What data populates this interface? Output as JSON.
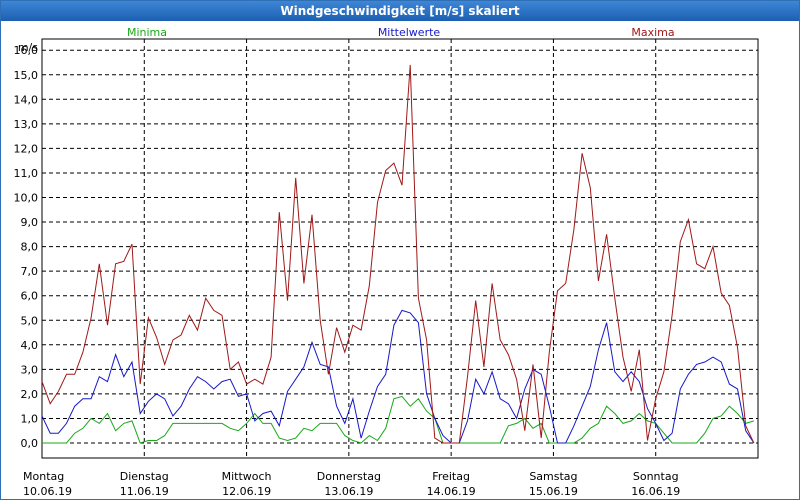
{
  "window": {
    "title": "Windgeschwindigkeit [m/s] skaliert"
  },
  "chart_data": {
    "type": "line",
    "title": "Windgeschwindigkeit [m/s] skaliert",
    "ylabel": "m/s",
    "ylim": [
      0,
      16.5
    ],
    "yticks": [
      "0,0",
      "1,0",
      "2,0",
      "3,0",
      "4,0",
      "5,0",
      "6,0",
      "7,0",
      "8,0",
      "9,0",
      "10,0",
      "11,0",
      "12,0",
      "13,0",
      "14,0",
      "15,0",
      "16,0"
    ],
    "xlim": [
      0,
      7
    ],
    "grid": true,
    "legend": "top",
    "days": [
      {
        "weekday": "Montag",
        "date": "10.06.19"
      },
      {
        "weekday": "Dienstag",
        "date": "11.06.19"
      },
      {
        "weekday": "Mittwoch",
        "date": "12.06.19"
      },
      {
        "weekday": "Donnerstag",
        "date": "13.06.19"
      },
      {
        "weekday": "Freitag",
        "date": "14.06.19"
      },
      {
        "weekday": "Samstag",
        "date": "15.06.19"
      },
      {
        "weekday": "Sonntag",
        "date": "16.06.19"
      }
    ],
    "series": [
      {
        "name": "Minima",
        "color": "#18a818",
        "x": [
          0,
          0.08,
          0.16,
          0.24,
          0.32,
          0.4,
          0.48,
          0.56,
          0.64,
          0.72,
          0.8,
          0.88,
          0.96,
          1.04,
          1.12,
          1.2,
          1.28,
          1.36,
          1.44,
          1.52,
          1.6,
          1.68,
          1.76,
          1.84,
          1.92,
          2,
          2.08,
          2.16,
          2.24,
          2.32,
          2.4,
          2.48,
          2.56,
          2.64,
          2.72,
          2.8,
          2.88,
          2.96,
          3.04,
          3.12,
          3.2,
          3.28,
          3.36,
          3.44,
          3.52,
          3.6,
          3.68,
          3.76,
          3.84,
          3.92,
          4,
          4.08,
          4.16,
          4.24,
          4.32,
          4.4,
          4.48,
          4.56,
          4.64,
          4.72,
          4.8,
          4.88,
          4.96,
          5.04,
          5.12,
          5.2,
          5.28,
          5.36,
          5.44,
          5.52,
          5.6,
          5.68,
          5.76,
          5.84,
          5.92,
          6,
          6.08,
          6.16,
          6.24,
          6.32,
          6.4,
          6.48,
          6.56,
          6.64,
          6.72,
          6.8,
          6.88,
          6.96
        ],
        "values": [
          0,
          0,
          0,
          0,
          0.4,
          0.6,
          1,
          0.8,
          1.2,
          0.5,
          0.8,
          0.9,
          0,
          0.1,
          0.1,
          0.3,
          0.8,
          0.8,
          0.8,
          0.8,
          0.8,
          0.8,
          0.8,
          0.6,
          0.5,
          0.8,
          1.2,
          0.8,
          0.8,
          0.2,
          0.1,
          0.2,
          0.6,
          0.5,
          0.8,
          0.8,
          0.8,
          0.3,
          0.1,
          0,
          0.3,
          0.1,
          0.6,
          1.8,
          1.9,
          1.5,
          1.8,
          1.3,
          1,
          0,
          0,
          0,
          0,
          0,
          0,
          0,
          0,
          0.7,
          0.8,
          1,
          0.6,
          0.8,
          0,
          0,
          0,
          0,
          0.2,
          0.6,
          0.8,
          1.5,
          1.2,
          0.8,
          0.9,
          1.2,
          0.9,
          0.8,
          0.4,
          0,
          0,
          0,
          0,
          0.4,
          1,
          1.1,
          1.5,
          1.2,
          0.8,
          0.9
        ]
      },
      {
        "name": "Mittelwerte",
        "color": "#1818c8",
        "x": [
          0,
          0.08,
          0.16,
          0.24,
          0.32,
          0.4,
          0.48,
          0.56,
          0.64,
          0.72,
          0.8,
          0.88,
          0.96,
          1.04,
          1.12,
          1.2,
          1.28,
          1.36,
          1.44,
          1.52,
          1.6,
          1.68,
          1.76,
          1.84,
          1.92,
          2,
          2.08,
          2.16,
          2.24,
          2.32,
          2.4,
          2.48,
          2.56,
          2.64,
          2.72,
          2.8,
          2.88,
          2.96,
          3.04,
          3.12,
          3.2,
          3.28,
          3.36,
          3.44,
          3.52,
          3.6,
          3.68,
          3.76,
          3.84,
          3.92,
          4,
          4.08,
          4.16,
          4.24,
          4.32,
          4.4,
          4.48,
          4.56,
          4.64,
          4.72,
          4.8,
          4.88,
          4.96,
          5.04,
          5.12,
          5.2,
          5.28,
          5.36,
          5.44,
          5.52,
          5.6,
          5.68,
          5.76,
          5.84,
          5.92,
          6,
          6.08,
          6.16,
          6.24,
          6.32,
          6.4,
          6.48,
          6.56,
          6.64,
          6.72,
          6.8,
          6.88,
          6.96
        ],
        "values": [
          1.1,
          0.4,
          0.4,
          0.8,
          1.5,
          1.8,
          1.8,
          2.7,
          2.5,
          3.6,
          2.7,
          3.3,
          1.2,
          1.7,
          2,
          1.8,
          1.1,
          1.5,
          2.2,
          2.7,
          2.5,
          2.2,
          2.5,
          2.6,
          1.9,
          2,
          0.9,
          1.2,
          1.3,
          0.7,
          2.1,
          2.6,
          3.1,
          4.1,
          3.2,
          3.1,
          1.5,
          0.8,
          1.8,
          0.2,
          1.3,
          2.3,
          2.8,
          4.8,
          5.4,
          5.3,
          4.9,
          2,
          1,
          0.3,
          0,
          0,
          0.9,
          2.6,
          2,
          2.9,
          1.8,
          1.6,
          1,
          2.2,
          3,
          2.8,
          1.5,
          0,
          0,
          0.7,
          1.5,
          2.3,
          3.8,
          4.9,
          2.9,
          2.5,
          2.9,
          2.5,
          1.4,
          0.8,
          0.1,
          0.4,
          2.2,
          2.8,
          3.2,
          3.3,
          3.5,
          3.3,
          2.4,
          2.2,
          0.5,
          0
        ]
      },
      {
        "name": "Maxima",
        "color": "#a01818",
        "x": [
          0,
          0.08,
          0.16,
          0.24,
          0.32,
          0.4,
          0.48,
          0.56,
          0.64,
          0.72,
          0.8,
          0.88,
          0.96,
          1.04,
          1.12,
          1.2,
          1.28,
          1.36,
          1.44,
          1.52,
          1.6,
          1.68,
          1.76,
          1.84,
          1.92,
          2,
          2.08,
          2.16,
          2.24,
          2.32,
          2.4,
          2.48,
          2.56,
          2.64,
          2.72,
          2.8,
          2.88,
          2.96,
          3.04,
          3.12,
          3.2,
          3.28,
          3.36,
          3.44,
          3.52,
          3.6,
          3.68,
          3.76,
          3.84,
          3.92,
          4,
          4.08,
          4.16,
          4.24,
          4.32,
          4.4,
          4.48,
          4.56,
          4.64,
          4.72,
          4.8,
          4.88,
          4.96,
          5.04,
          5.12,
          5.2,
          5.28,
          5.36,
          5.44,
          5.52,
          5.6,
          5.68,
          5.76,
          5.84,
          5.92,
          6,
          6.08,
          6.16,
          6.24,
          6.32,
          6.4,
          6.48,
          6.56,
          6.64,
          6.72,
          6.8,
          6.88,
          6.96
        ],
        "values": [
          2.5,
          1.6,
          2.1,
          2.8,
          2.8,
          3.7,
          5.1,
          7.3,
          4.8,
          7.3,
          7.4,
          8.1,
          2.4,
          5.1,
          4.3,
          3.2,
          4.2,
          4.4,
          5.2,
          4.6,
          5.9,
          5.4,
          5.2,
          3,
          3.3,
          2.4,
          2.6,
          2.4,
          3.5,
          9.4,
          5.8,
          10.8,
          6.5,
          9.3,
          5,
          2.8,
          4.7,
          3.7,
          4.8,
          4.6,
          6.4,
          9.8,
          11.1,
          11.4,
          10.5,
          15.4,
          5.9,
          4.2,
          0.2,
          0,
          0,
          0,
          2.7,
          5.8,
          3.1,
          6.5,
          4.2,
          3.6,
          2.6,
          0.5,
          3.2,
          0.2,
          3.7,
          6.2,
          6.5,
          8.7,
          11.8,
          10.4,
          6.6,
          8.5,
          5.9,
          3.5,
          2.1,
          3.8,
          0.1,
          1.8,
          2.9,
          5.2,
          8.2,
          9.1,
          7.3,
          7.1,
          8,
          6.1,
          5.6,
          3.9,
          0.7,
          0
        ]
      }
    ]
  }
}
